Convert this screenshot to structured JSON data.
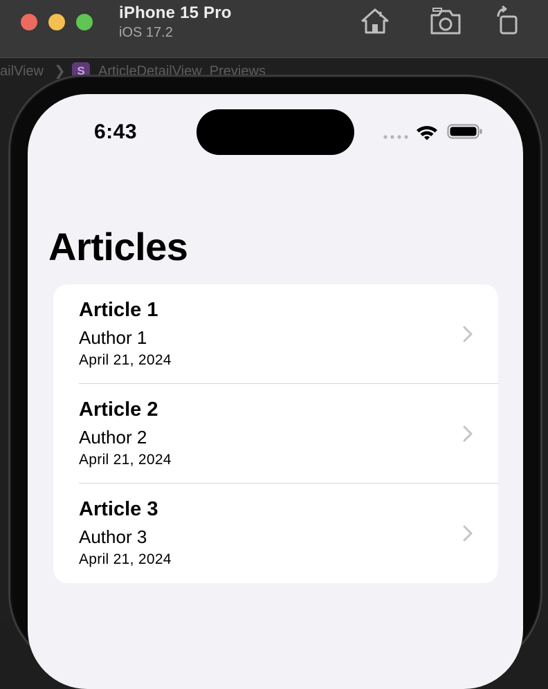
{
  "simulator": {
    "device_name": "iPhone 15 Pro",
    "os_version": "iOS 17.2",
    "toolbar_icons": [
      "home-icon",
      "screenshot-icon",
      "rotate-icon"
    ]
  },
  "editor": {
    "breadcrumb_1": "ailView",
    "breadcrumb_sep": "❯",
    "swift_badge": "S",
    "breadcrumb_2": "ArticleDetailView_Previews"
  },
  "status_bar": {
    "time": "6:43"
  },
  "nav": {
    "title": "Articles"
  },
  "articles": [
    {
      "title": "Article 1",
      "author": "Author 1",
      "date": "April 21, 2024"
    },
    {
      "title": "Article 2",
      "author": "Author 2",
      "date": "April 21, 2024"
    },
    {
      "title": "Article 3",
      "author": "Author 3",
      "date": "April 21, 2024"
    }
  ],
  "colors": {
    "screen_background": "#f2f2f7",
    "list_background": "#ffffff",
    "chevron": "#c4c4c7",
    "traffic_red": "#ed6a5e",
    "traffic_yellow": "#f5bf4f",
    "traffic_green": "#61c554"
  }
}
